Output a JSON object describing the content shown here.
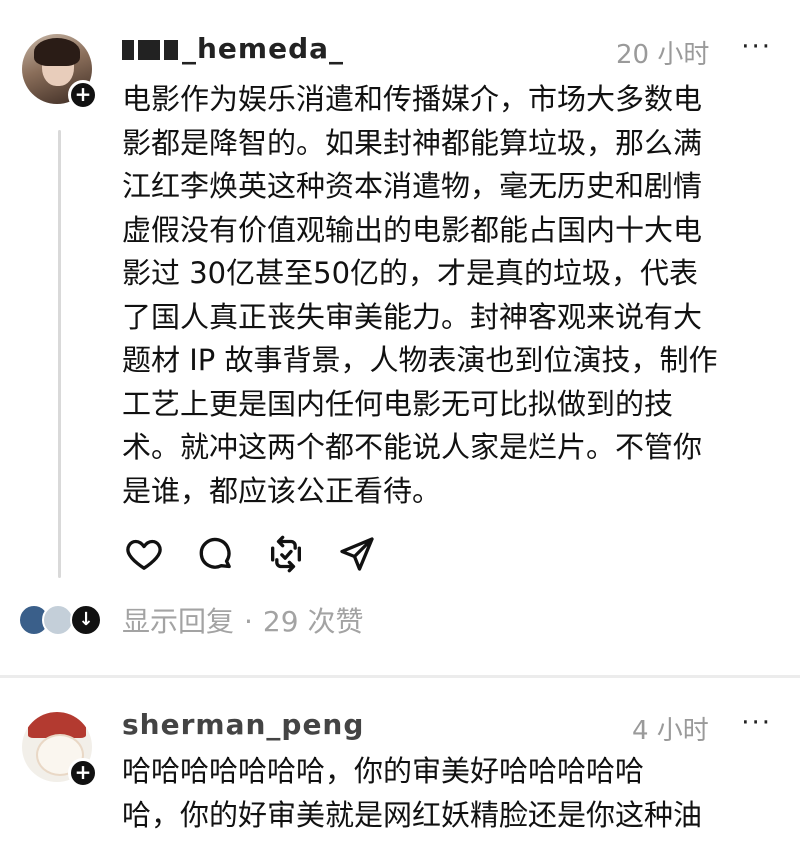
{
  "posts": [
    {
      "username": "_hemeda_",
      "time": "20 小时",
      "more": "···",
      "content_lines": [
        "电影作为娱乐消遣和传播媒介，市场大多数电",
        "影都是降智的。如果封神都能算垃圾，那么满",
        "江红李焕英这种资本消遣物，毫无历史和剧情",
        "虚假没有价值观输出的电影都能占国内十大电",
        "影过 30亿甚至50亿的，才是真的垃圾，代表",
        "了国人真正丧失审美能力。封神客观来说有大",
        "题材 IP 故事背景，人物表演也到位演技，制作",
        "工艺上更是国内任何电影无可比拟做到的技",
        "术。就冲这两个都不能说人家是烂片。不管你",
        "是谁，都应该公正看待。"
      ],
      "show_replies": "显示回复",
      "separator": "·",
      "likes": "29 次赞",
      "icons": [
        "heart-icon",
        "comment-icon",
        "repost-icon",
        "share-icon",
        "plus-icon"
      ]
    },
    {
      "username": "sherman_peng",
      "time": "4 小时",
      "more": "···",
      "content_lines": [
        "哈哈哈哈哈哈哈，你的审美好哈哈哈哈哈",
        "哈，你的好审美就是网红妖精脸还是你这种油"
      ]
    }
  ],
  "colors": {
    "text": "#111111",
    "muted": "#9a9a9a",
    "thread_line": "#d9d9d9",
    "divider": "#ececec"
  }
}
